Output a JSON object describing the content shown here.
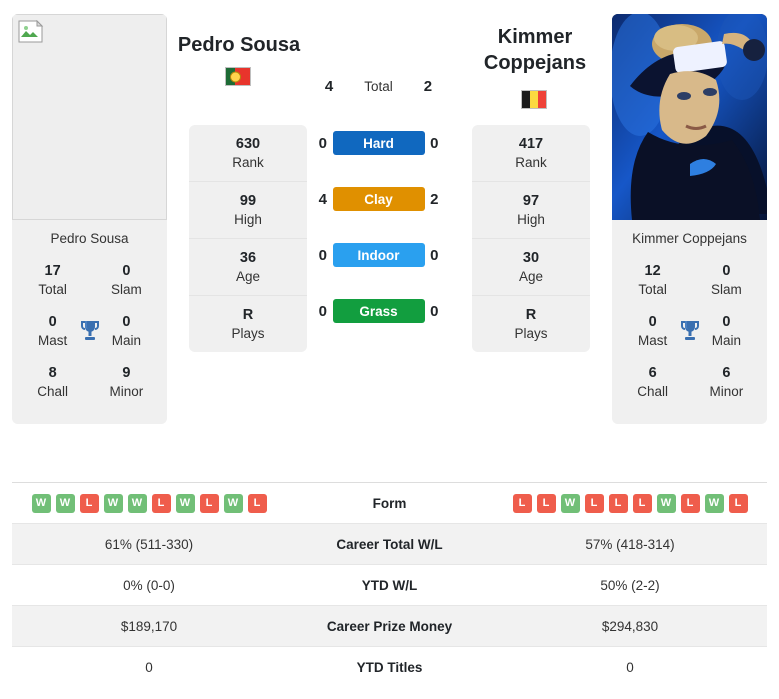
{
  "players": {
    "left": {
      "name": "Pedro Sousa",
      "caption": "Pedro Sousa",
      "flag": "portugal-flag",
      "photo": "missing-image",
      "stats": [
        {
          "value": "630",
          "label": "Rank"
        },
        {
          "value": "99",
          "label": "High"
        },
        {
          "value": "36",
          "label": "Age"
        },
        {
          "value": "R",
          "label": "Plays"
        }
      ],
      "titles": [
        {
          "value": "17",
          "label": "Total"
        },
        {
          "value": "0",
          "label": "Slam"
        },
        {
          "value": "0",
          "label": "Mast"
        },
        {
          "value": "0",
          "label": "Main"
        },
        {
          "value": "8",
          "label": "Chall"
        },
        {
          "value": "9",
          "label": "Minor"
        }
      ],
      "form": [
        "W",
        "W",
        "L",
        "W",
        "W",
        "L",
        "W",
        "L",
        "W",
        "L"
      ],
      "career_total_wl": "61% (511-330)",
      "ytd_wl": "0% (0-0)",
      "career_prize_money": "$189,170",
      "ytd_titles": "0"
    },
    "right": {
      "name": "Kimmer Coppejans",
      "caption": "Kimmer Coppejans",
      "flag": "belgium-flag",
      "photo": "player-photo",
      "stats": [
        {
          "value": "417",
          "label": "Rank"
        },
        {
          "value": "97",
          "label": "High"
        },
        {
          "value": "30",
          "label": "Age"
        },
        {
          "value": "R",
          "label": "Plays"
        }
      ],
      "titles": [
        {
          "value": "12",
          "label": "Total"
        },
        {
          "value": "0",
          "label": "Slam"
        },
        {
          "value": "0",
          "label": "Mast"
        },
        {
          "value": "0",
          "label": "Main"
        },
        {
          "value": "6",
          "label": "Chall"
        },
        {
          "value": "6",
          "label": "Minor"
        }
      ],
      "form": [
        "L",
        "L",
        "W",
        "L",
        "L",
        "L",
        "W",
        "L",
        "W",
        "L"
      ],
      "career_total_wl": "57% (418-314)",
      "ytd_wl": "50% (2-2)",
      "career_prize_money": "$294,830",
      "ytd_titles": "0"
    }
  },
  "head_to_head": {
    "total": {
      "label": "Total",
      "left": "4",
      "right": "2"
    },
    "surfaces": [
      {
        "label": "Hard",
        "left": "0",
        "right": "0",
        "color": "#1068bf"
      },
      {
        "label": "Clay",
        "left": "4",
        "right": "2",
        "color": "#e09000"
      },
      {
        "label": "Indoor",
        "left": "0",
        "right": "0",
        "color": "#2aa0ef"
      },
      {
        "label": "Grass",
        "left": "0",
        "right": "0",
        "color": "#129e3f"
      }
    ]
  },
  "comparison_rows": [
    {
      "label": "Form",
      "type": "form"
    },
    {
      "label": "Career Total W/L",
      "left": "61% (511-330)",
      "right": "57% (418-314)"
    },
    {
      "label": "YTD W/L",
      "left": "0% (0-0)",
      "right": "50% (2-2)"
    },
    {
      "label": "Career Prize Money",
      "left": "$189,170",
      "right": "$294,830"
    },
    {
      "label": "YTD Titles",
      "left": "0",
      "right": "0"
    }
  ],
  "colors": {
    "win": "#71bf77",
    "loss": "#ef5d4c",
    "trophy": "#3a6fb0",
    "card_bg": "#f0f0f0"
  },
  "icons": {
    "trophy": "trophy-icon",
    "broken_image": "broken-image-icon"
  }
}
